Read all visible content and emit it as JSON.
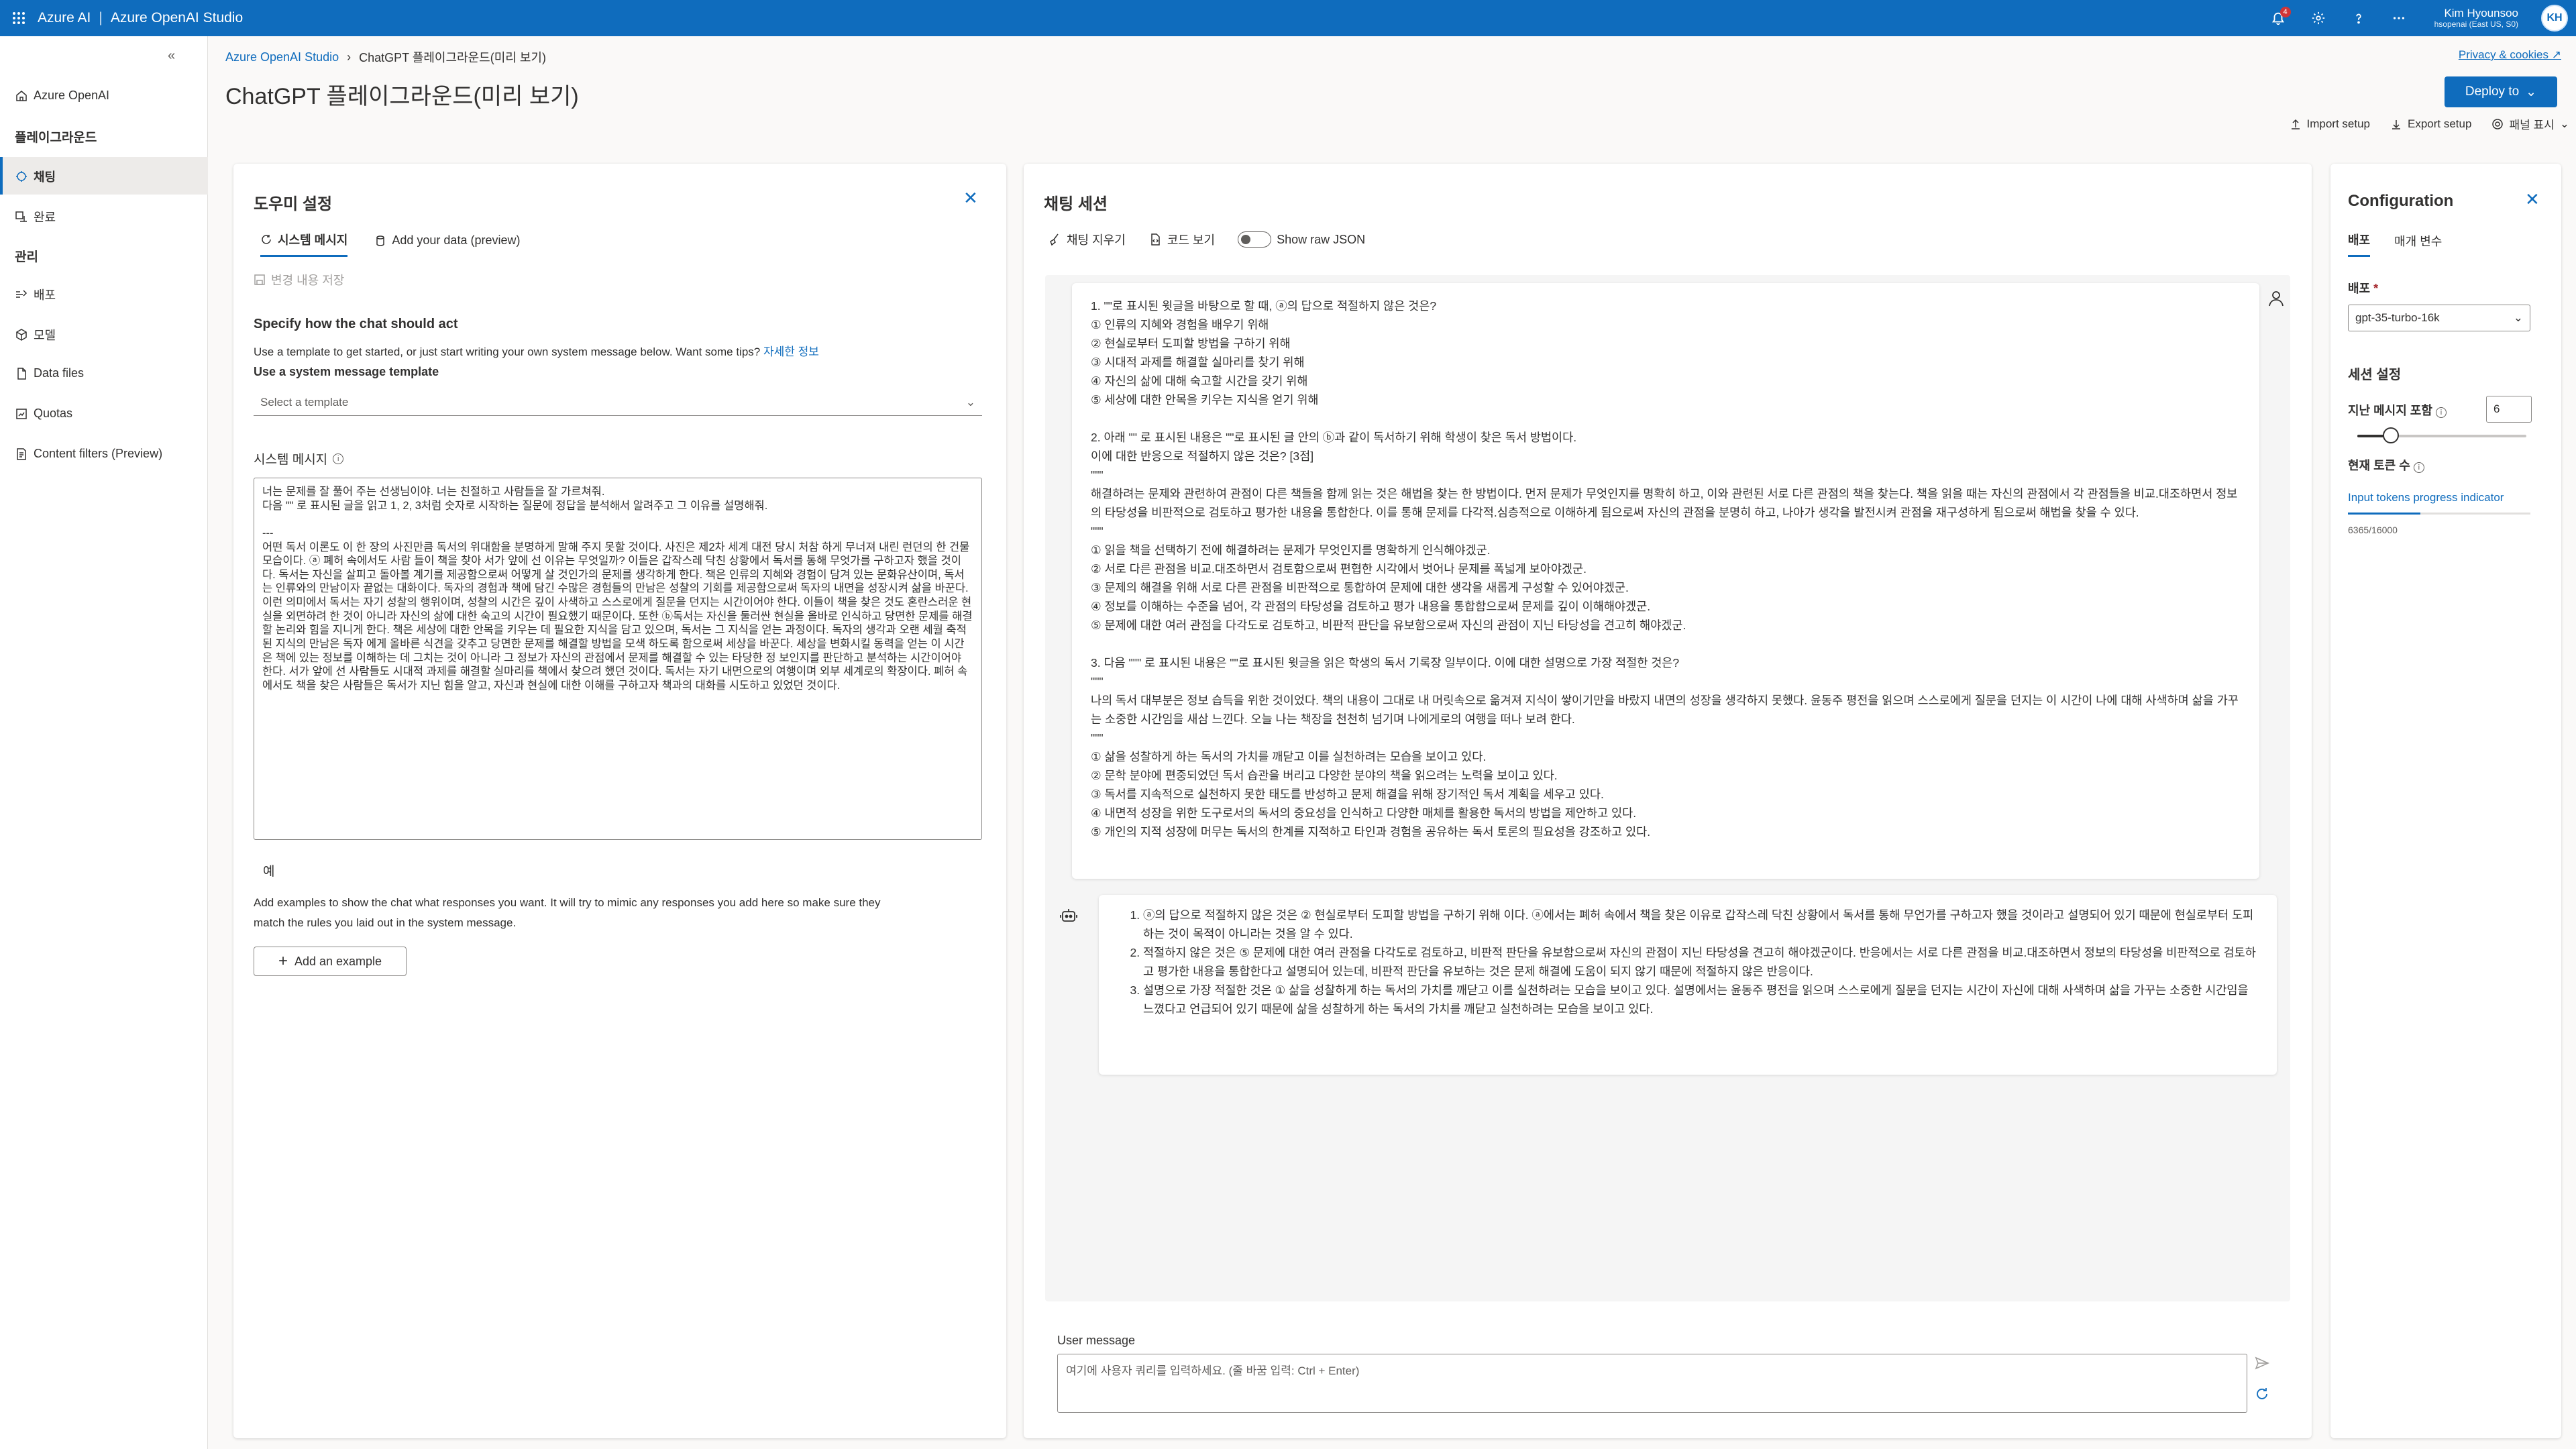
{
  "topbar": {
    "brand_left": "Azure AI",
    "brand_sep": "|",
    "brand_right": "Azure OpenAI Studio",
    "notification_count": "4",
    "user_name": "Kim Hyounsoo",
    "user_sub": "hsopenai (East US, S0)",
    "avatar_initials": "KH",
    "accent_color": "#0f6cbd"
  },
  "nav": {
    "azure_openai": "Azure OpenAI",
    "section_playground": "플레이그라운드",
    "chat": "채팅",
    "completions": "완료",
    "section_manage": "관리",
    "deployments": "배포",
    "models": "모델",
    "data_files": "Data files",
    "quotas": "Quotas",
    "content_filters": "Content filters (Preview)"
  },
  "header": {
    "breadcrumb_root": "Azure OpenAI Studio",
    "breadcrumb_current": "ChatGPT 플레이그라운드(미리 보기)",
    "page_title": "ChatGPT 플레이그라운드(미리 보기)",
    "privacy": "Privacy & cookies",
    "deploy_to": "Deploy to",
    "import_setup": "Import setup",
    "export_setup": "Export setup",
    "panel_display": "패널 표시"
  },
  "setup": {
    "title": "도우미 설정",
    "tab_system": "시스템 메시지",
    "tab_data": "Add your data (preview)",
    "save_changes": "변경 내용 저장",
    "heading": "Specify how the chat should act",
    "desc": "Use a template to get started, or just start writing your own system message below. Want some tips?",
    "desc_link": "자세한 정보",
    "template_label": "Use a system message template",
    "template_placeholder": "Select a template",
    "sysmsg_label": "시스템 메시지",
    "sysmsg_text": "너는 문제를 잘 풀어 주는 선생님이야. 너는 친절하고 사람들을 잘 가르쳐줘.\n다음 \"\" 로 표시된 글을 읽고 1, 2, 3처럼 숫자로 시작하는 질문에 정답을 분석해서 알려주고 그 이유를 설명해줘.\n\n---\n어떤 독서 이론도 이 한 장의 사진만큼 독서의 위대함을 분명하게 말해 주지 못할 것이다. 사진은 제2차 세계 대전 당시 처참 하게 무너져 내린 런던의 한 건물 모습이다. ⓐ 폐허 속에서도 사람 들이 책을 찾아 서가 앞에 선 이유는 무엇일까? 이들은 갑작스레 닥친 상황에서 독서를 통해 무엇가를 구하고자 했을 것이다. 독서는 자신을 살피고 돌아볼 계기를 제공함으로써 어떻게 살 것인가의 문제를 생각하게 한다. 책은 인류의 지혜와 경험이 담겨 있는 문화유산이며, 독서는 인류와의 만남이자 끝없는 대화이다. 독자의 경험과 책에 담긴 수많은 경험들의 만남은 성찰의 기회를 제공함으로써 독자의 내면을 성장시켜 삶을 바꾼다. 이런 의미에서 독서는 자기 성찰의 행위이며, 성찰의 시간은 깊이 사색하고 스스로에게 질문을 던지는 시간이어야 한다. 이들이 책을 찾은 것도 혼란스러운 현실을 외면하려 한 것이 아니라 자신의 삶에 대한 숙고의 시간이 필요했기 때문이다. 또한 ⓑ독서는 자신을 둘러싼 현실을 올바로 인식하고 당면한 문제를 해결할 논리와 힘을 지니게 한다. 책은 세상에 대한 안목을 키우는 데 필요한 지식을 담고 있으며, 독서는 그 지식을 얻는 과정이다. 독자의 생각과 오랜 세월 축적된 지식의 만남은 독자 에게 올바른 식견을 갖추고 당면한 문제를 해결할 방법을 모색 하도록 함으로써 세상을 바꾼다. 세상을 변화시킬 동력을 얻는 이 시간은 책에 있는 정보를 이해하는 데 그치는 것이 아니라 그 정보가 자신의 관점에서 문제를 해결할 수 있는 타당한 정 보인지를 판단하고 분석하는 시간이어야 한다. 서가 앞에 선 사람들도 시대적 과제를 해결할 실마리를 책에서 찾으려 했던 것이다. 독서는 자기 내면으로의 여행이며 외부 세계로의 확장이다. 폐허 속에서도 책을 찾은 사람들은 독서가 지닌 힘을 알고, 자신과 현실에 대한 이해를 구하고자 책과의 대화를 시도하고 있었던 것이다.",
    "examples_label": "예",
    "examples_desc_1": "Add examples to show the chat what responses you want. It will try to mimic any responses you add here so make sure they",
    "examples_desc_2": "match the rules you laid out in the system message.",
    "add_example": "Add an example"
  },
  "chat": {
    "title": "채팅 세션",
    "clear_chat": "채팅 지우기",
    "view_code": "코드 보기",
    "show_raw_json": "Show raw JSON",
    "user_message_text": "1. \"\"로 표시된 윗글을 바탕으로 할 때, ⓐ의 답으로 적절하지 않은 것은?\n① 인류의 지혜와 경험을 배우기 위해\n② 현실로부터 도피할 방법을 구하기 위해\n③ 시대적 과제를 해결할 실마리를 찾기 위해\n④ 자신의 삶에 대해 숙고할 시간을 갖기 위해\n⑤ 세상에 대한 안목을 키우는 지식을 얻기 위해\n\n2. 아래 \"\" 로 표시된 내용은 \"\"로 표시된 글 안의 ⓑ과 같이 독서하기 위해 학생이 찾은 독서 방법이다.\n이에 대한 반응으로 적절하지 않은 것은? [3점]\n\"\"\"\n해결하려는 문제와 관련하여 관점이 다른 책들을 함께 읽는 것은 해법을 찾는 한 방법이다. 먼저 문제가 무엇인지를 명확히 하고, 이와 관련된 서로 다른 관점의 책을 찾는다. 책을 읽을 때는 자신의 관점에서 각 관점들을 비교.대조하면서 정보의 타당성을 비판적으로 검토하고 평가한 내용을 통합한다. 이를 통해 문제를 다각적.심층적으로 이해하게 됨으로써 자신의 관점을 분명히 하고, 나아가 생각을 발전시켜 관점을 재구성하게 됨으로써 해법을 찾을 수 있다.\n\"\"\"\n① 읽을 책을 선택하기 전에 해결하려는 문제가 무엇인지를 명확하게 인식해야겠군.\n② 서로 다른 관점을 비교.대조하면서 검토함으로써 편협한 시각에서 벗어나 문제를 폭넓게 보아야겠군.\n③ 문제의 해결을 위해 서로 다른 관점을 비판적으로 통합하여 문제에 대한 생각을 새롭게 구성할 수 있어야겠군.\n④ 정보를 이해하는 수준을 넘어, 각 관점의 타당성을 검토하고 평가 내용을 통합함으로써 문제를 깊이 이해해야겠군.\n⑤ 문제에 대한 여러 관점을 다각도로 검토하고, 비판적 판단을 유보함으로써 자신의 관점이 지닌 타당성을 견고히 해야겠군.\n\n3. 다음 \"\"\" 로 표시된 내용은 \"\"로 표시된 윗글을 읽은 학생의 독서 기록장 일부이다. 이에 대한 설명으로 가장 적절한 것은?\n\"\"\"\n나의 독서 대부분은 정보 습득을 위한 것이었다. 책의 내용이 그대로 내 머릿속으로 옮겨져 지식이 쌓이기만을 바랐지 내면의 성장을 생각하지 못했다. 윤동주 평전을 읽으며 스스로에게 질문을 던지는 이 시간이 나에 대해 사색하며 삶을 가꾸는 소중한 시간임을 새삼 느낀다. 오늘 나는 책장을 천천히 넘기며 나에게로의 여행을 떠나 보려 한다.\n\"\"\"\n① 삶을 성찰하게 하는 독서의 가치를 깨닫고 이를 실천하려는 모습을 보이고 있다.\n② 문학 분야에 편중되었던 독서 습관을 버리고 다양한 분야의 책을 읽으려는 노력을 보이고 있다.\n③ 독서를 지속적으로 실천하지 못한 태도를 반성하고 문제 해결을 위해 장기적인 독서 계획을 세우고 있다.\n④ 내면적 성장을 위한 도구로서의 독서의 중요성을 인식하고 다양한 매체를 활용한 독서의 방법을 제안하고 있다.\n⑤ 개인의 지적 성장에 머무는 독서의 한계를 지적하고 타인과 경험을 공유하는 독서 토론의 필요성을 강조하고 있다.",
    "assistant_answers": [
      "ⓐ의 답으로 적절하지 않은 것은 ② 현실로부터 도피할 방법을 구하기 위해 이다. ⓐ에서는 폐허 속에서 책을 찾은 이유로 갑작스레 닥친 상황에서 독서를 통해 무언가를 구하고자 했을 것이라고 설명되어 있기 때문에 현실로부터 도피하는 것이 목적이 아니라는 것을 알 수 있다.",
      "적절하지 않은 것은 ⑤ 문제에 대한 여러 관점을 다각도로 검토하고, 비판적 판단을 유보함으로써 자신의 관점이 지닌 타당성을 견고히 해야겠군이다. 반응에서는 서로 다른 관점을 비교.대조하면서 정보의 타당성을 비판적으로 검토하고 평가한 내용을 통합한다고 설명되어 있는데, 비판적 판단을 유보하는 것은 문제 해결에 도움이 되지 않기 때문에 적절하지 않은 반응이다.",
      "설명으로 가장 적절한 것은 ① 삶을 성찰하게 하는 독서의 가치를 깨닫고 이를 실천하려는 모습을 보이고 있다. 설명에서는 윤동주 평전을 읽으며 스스로에게 질문을 던지는 시간이 자신에 대해 사색하며 삶을 가꾸는 소중한 시간임을 느꼈다고 언급되어 있기 때문에 삶을 성찰하게 하는 독서의 가치를 깨닫고 실천하려는 모습을 보이고 있다."
    ],
    "user_message_label": "User message",
    "input_placeholder": "여기에 사용자 쿼리를 입력하세요. (줄 바꿈 입력: Ctrl + Enter)"
  },
  "config": {
    "title": "Configuration",
    "tab_deploy": "배포",
    "tab_params": "매개 변수",
    "deploy_label": "배포",
    "deploy_value": "gpt-35-turbo-16k",
    "session_heading": "세션 설정",
    "past_messages_label": "지난 메시지 포함",
    "past_messages_value": "6",
    "past_messages_fraction": 0.2,
    "current_tokens_label": "현재 토큰 수",
    "tokens_indicator": "Input tokens progress indicator",
    "tokens_count": "6365/16000",
    "tokens_fraction": 0.398
  }
}
